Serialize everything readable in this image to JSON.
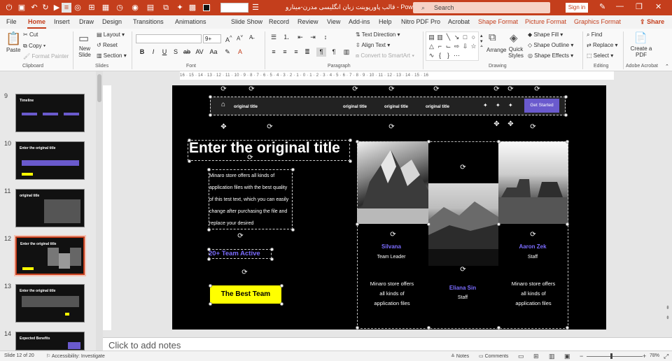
{
  "titlebar": {
    "document_title": "قالب پاورپوینت زبان انگلیسی مدرن-مینارو  -  PowerPoint",
    "search_placeholder": "Search",
    "signin_label": "Sign in"
  },
  "tabs": [
    "File",
    "Home",
    "Insert",
    "Draw",
    "Design",
    "Transitions",
    "Animations",
    "Slide Show",
    "Record",
    "Review",
    "View",
    "Add-ins",
    "Help",
    "Nitro PDF Pro",
    "Acrobat",
    "Shape Format",
    "Picture Format",
    "Graphics Format"
  ],
  "share_label": "Share",
  "ribbon": {
    "clipboard": {
      "paste": "Paste",
      "cut": "Cut",
      "copy": "Copy",
      "format_painter": "Format Painter",
      "label": "Clipboard"
    },
    "slides": {
      "new_slide": "New Slide",
      "layout": "Layout",
      "reset": "Reset",
      "section": "Section",
      "label": "Slides"
    },
    "font": {
      "size": "9+",
      "label": "Font"
    },
    "paragraph": {
      "text_direction": "Text Direction",
      "align_text": "Align Text",
      "smartart": "Convert to SmartArt",
      "label": "Paragraph"
    },
    "drawing": {
      "arrange": "Arrange",
      "quick_styles": "Quick Styles",
      "shape_fill": "Shape Fill",
      "shape_outline": "Shape Outline",
      "shape_effects": "Shape Effects",
      "label": "Drawing"
    },
    "editing": {
      "find": "Find",
      "replace": "Replace",
      "select": "Select",
      "label": "Editing"
    },
    "acrobat": {
      "create_pdf": "Create a PDF",
      "label": "Adobe Acrobat"
    }
  },
  "slides_panel": {
    "items": [
      {
        "num": "9",
        "title": "Timeline"
      },
      {
        "num": "10",
        "title": "Enter the original title"
      },
      {
        "num": "11",
        "title": "original title"
      },
      {
        "num": "12",
        "title": "Enter the original title"
      },
      {
        "num": "13",
        "title": "Enter the original title"
      },
      {
        "num": "14",
        "title": "Expected Benefits"
      }
    ]
  },
  "ruler_text": "16 · 15 · 14 · 13 · 12 · 11 · 10 · 9 · 8 · 7 · 6 · 5 · 4 · 3 · 2 · 1 · 0 · 1 · 2 · 3 · 4 · 5 · 6 · 7 · 8 · 9 · 10 · 11 · 12 · 13 · 14 · 15 · 16",
  "slide": {
    "nav": {
      "item1": "original title",
      "item2": "original title",
      "item3": "original title",
      "item4": "original title",
      "cta": "Get Started"
    },
    "title": "Enter the original title",
    "body_lines": [
      "Minaro store offers all kinds of",
      "application files with the best quality",
      "of this test text, which you can easily",
      "change after purchasing the file and",
      "replace your desired"
    ],
    "team_active": "20+ Team Active",
    "best_team": "The Best Team",
    "member1": {
      "name": "Silvana",
      "role": "Team Leader"
    },
    "member2": {
      "name": "Eliana Sin",
      "role": "Staff"
    },
    "member3": {
      "name": "Aaron Zek",
      "role": "Staff"
    },
    "caption_lines": [
      "Minaro store offers",
      "all kinds of",
      "application files"
    ]
  },
  "notes_placeholder": "Click to add notes",
  "status": {
    "slide_of": "Slide 12 of 20",
    "accessibility": "Accessibility: Investigate",
    "notes": "Notes",
    "comments": "Comments",
    "zoom": "78%"
  },
  "colors": {
    "accent": "#c43e1c",
    "purple": "#6a5acd",
    "yellow": "#ffff00"
  }
}
